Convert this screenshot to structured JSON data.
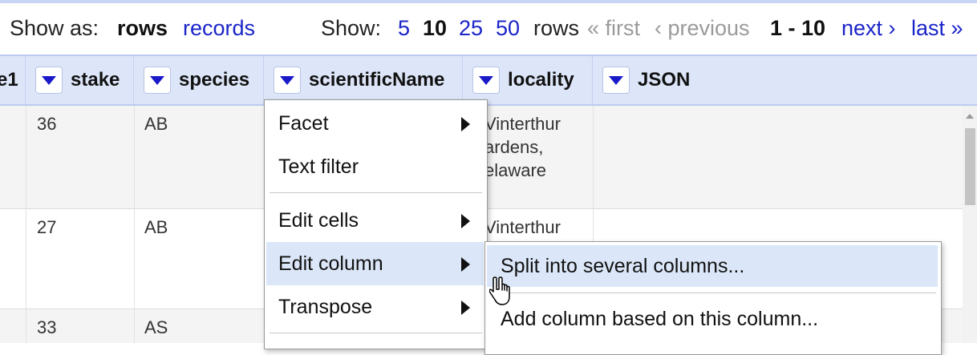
{
  "view": {
    "show_as_label": "Show as:",
    "mode_rows": "rows",
    "mode_records": "records",
    "show_label": "Show:",
    "page_sizes": [
      "5",
      "10",
      "25",
      "50"
    ],
    "page_size_selected": "10",
    "rows_label": "rows",
    "first": "« first",
    "previous": "‹ previous",
    "range": "1 - 10",
    "next": "next ›",
    "last": "last »"
  },
  "columns": [
    "e1",
    "stake",
    "species",
    "scientificName",
    "locality",
    "JSON"
  ],
  "rows": [
    {
      "stake": "36",
      "species": "AB",
      "locality": [
        "Vinterthur",
        "ardens,",
        "elaware"
      ]
    },
    {
      "stake": "27",
      "species": "AB",
      "locality": [
        "Vinterthur"
      ]
    },
    {
      "stake": "33",
      "species": "AS",
      "locality": []
    }
  ],
  "column_menu": {
    "items": [
      "Facet",
      "Text filter",
      "Edit cells",
      "Edit column",
      "Transpose"
    ]
  },
  "submenu": {
    "items": [
      "Split into several columns...",
      "Add column based on this column..."
    ]
  },
  "colors": {
    "accent": "#1a24c8",
    "header_bg": "#dde6f8",
    "highlight": "#dbe7f8"
  }
}
